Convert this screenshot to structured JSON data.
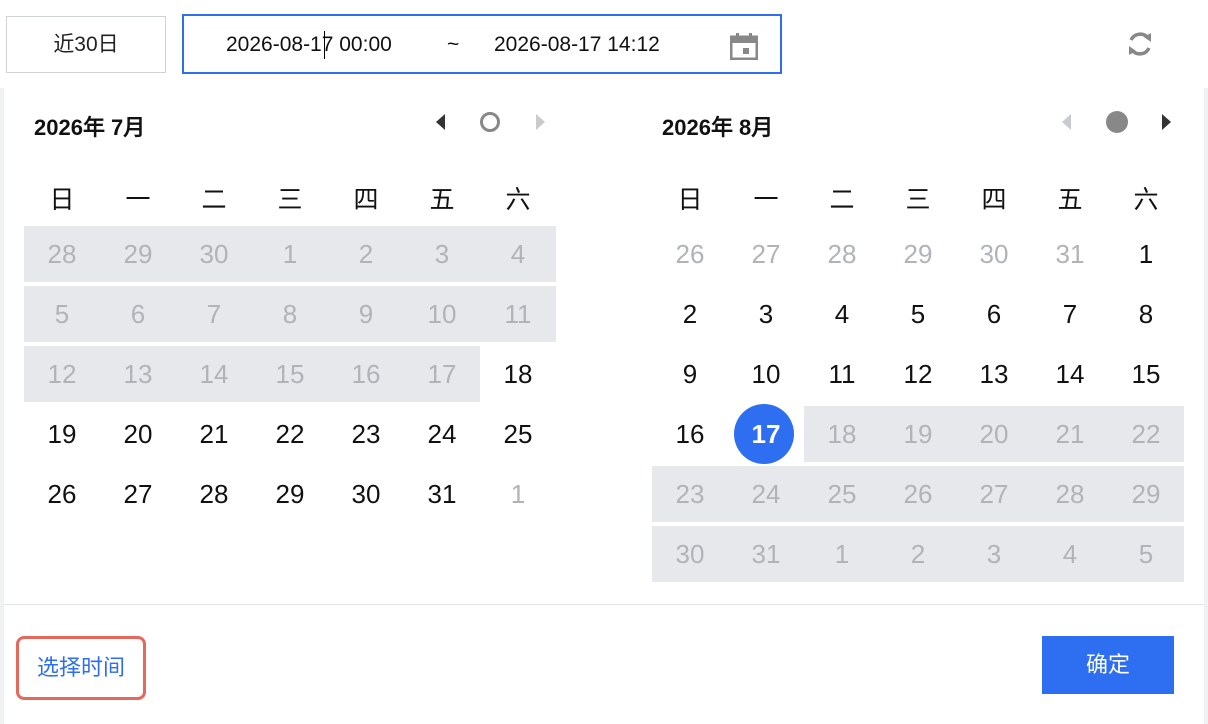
{
  "toolbar": {
    "range_button": "近30日",
    "start_value": "2026-08-17 00:00",
    "separator": "~",
    "end_value": "2026-08-17 14:12"
  },
  "calendars": [
    {
      "title": "2026年 7月",
      "weekdays": [
        "日",
        "一",
        "二",
        "三",
        "四",
        "五",
        "六"
      ],
      "rows": [
        [
          "28",
          "29",
          "30",
          "1",
          "2",
          "3",
          "4"
        ],
        [
          "5",
          "6",
          "7",
          "8",
          "9",
          "10",
          "11"
        ],
        [
          "12",
          "13",
          "14",
          "15",
          "16",
          "17",
          "18"
        ],
        [
          "19",
          "20",
          "21",
          "22",
          "23",
          "24",
          "25"
        ],
        [
          "26",
          "27",
          "28",
          "29",
          "30",
          "31",
          "1"
        ]
      ]
    },
    {
      "title": "2026年 8月",
      "weekdays": [
        "日",
        "一",
        "二",
        "三",
        "四",
        "五",
        "六"
      ],
      "rows": [
        [
          "26",
          "27",
          "28",
          "29",
          "30",
          "31",
          "1"
        ],
        [
          "2",
          "3",
          "4",
          "5",
          "6",
          "7",
          "8"
        ],
        [
          "9",
          "10",
          "11",
          "12",
          "13",
          "14",
          "15"
        ],
        [
          "16",
          "17",
          "18",
          "19",
          "20",
          "21",
          "22"
        ],
        [
          "23",
          "24",
          "25",
          "26",
          "27",
          "28",
          "29"
        ],
        [
          "30",
          "31",
          "1",
          "2",
          "3",
          "4",
          "5"
        ]
      ]
    }
  ],
  "footer": {
    "pick_time": "选择时间",
    "confirm": "确定"
  },
  "colors": {
    "accent": "#2e6ef0",
    "highlight_border": "#e4685c",
    "disabled_bg": "#e7e8eb",
    "muted_text": "#b0b3b8"
  }
}
